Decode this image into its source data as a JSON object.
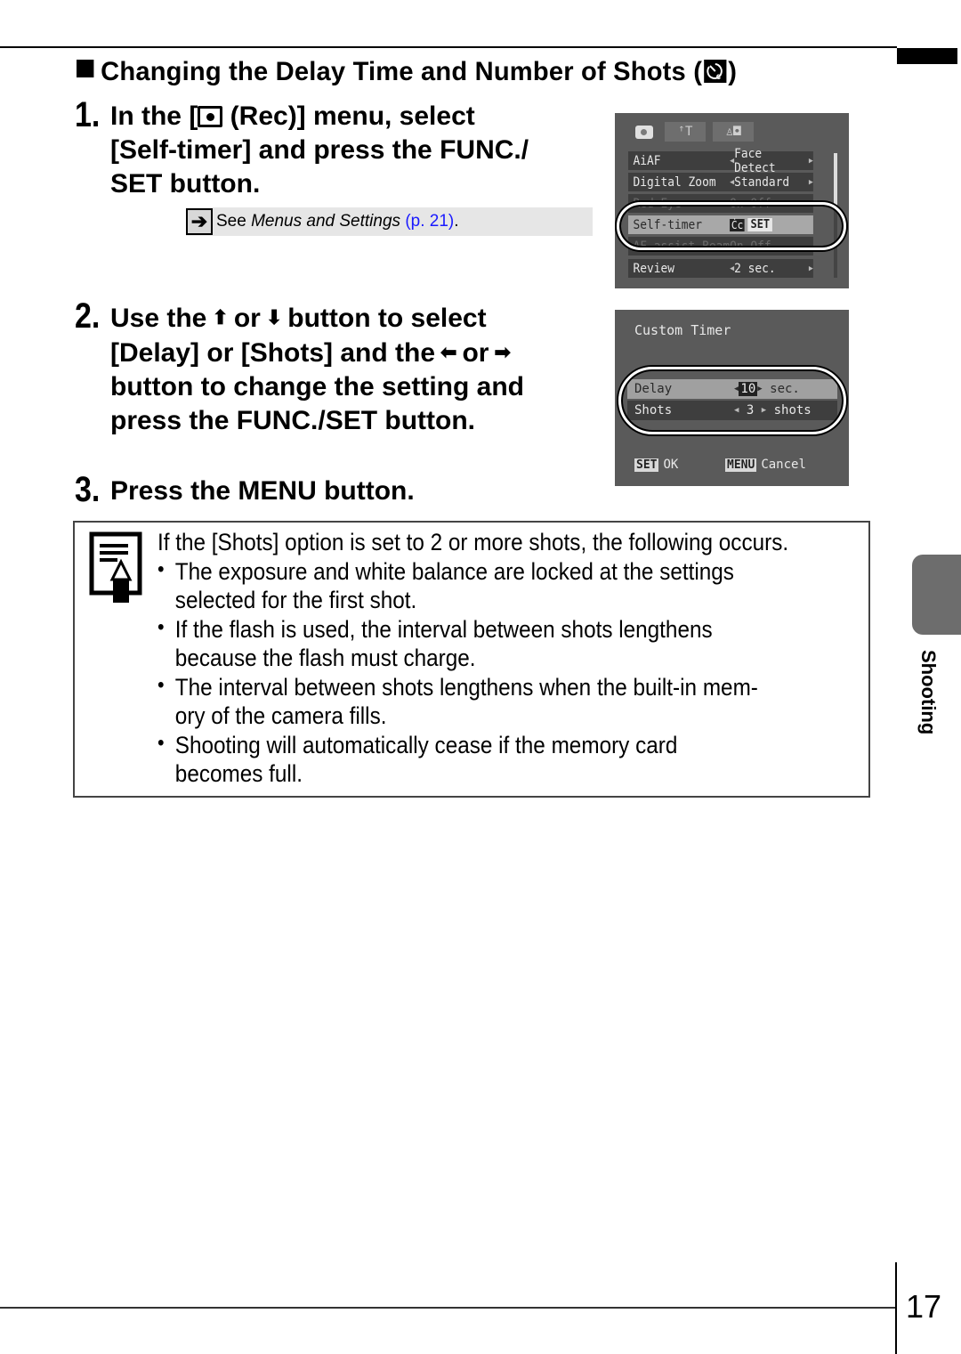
{
  "section": {
    "title": "Changing the Delay Time and Number of Shots (",
    "title_end": ")",
    "title_icon": "custom-self-timer-icon"
  },
  "steps": [
    {
      "number": "1.",
      "lines": [
        "In the [",
        " (Rec)] menu, select",
        "[Self-timer] and press the FUNC./",
        "SET button."
      ],
      "icon": "rec-camera-icon"
    },
    {
      "number": "2.",
      "line1_a": "Use the",
      "line1_b": "or",
      "line1_c": "button to select",
      "line2_a": "[Delay] or [Shots] and the",
      "line2_b": "or",
      "line3": "button to change the setting and",
      "line4": "press the FUNC./SET button.",
      "icons": [
        "up-arrow-icon",
        "down-arrow-icon",
        "left-arrow-icon",
        "right-arrow-icon"
      ]
    },
    {
      "number": "3.",
      "text": "Press the MENU button."
    }
  ],
  "see_reference": {
    "prefix": "See ",
    "title": "Menus and Settings",
    "page_link": "(p. 21)",
    "suffix": ".",
    "link_color": "#1a1aff"
  },
  "screen1": {
    "tabs": [
      "camera",
      "tools",
      "my-menu"
    ],
    "rows": [
      {
        "label": "AiAF",
        "value": "Face Detect"
      },
      {
        "label": "Digital Zoom",
        "value": "Standard"
      },
      {
        "label": "Red-Eye",
        "value": "On Off"
      },
      {
        "label": "Self-timer",
        "value": "SET",
        "selected": true
      },
      {
        "label": "AF-assist Beam",
        "value": "On Off"
      },
      {
        "label": "Review",
        "value": "2 sec."
      }
    ]
  },
  "screen2": {
    "title": "Custom Timer",
    "delay_label": "Delay",
    "delay_value": "10",
    "delay_unit": "sec.",
    "shots_label": "Shots",
    "shots_value": "3",
    "shots_unit": "shots",
    "ok_key": "SET",
    "ok_label": "OK",
    "cancel_key": "MENU",
    "cancel_label": "Cancel"
  },
  "note": {
    "intro": "If the [Shots] option is set to 2 or more shots, the following occurs.",
    "bullets": [
      [
        "The exposure and white balance are locked at the settings",
        "selected for the first shot."
      ],
      [
        "If the flash is used, the interval between shots lengthens",
        "because the flash must charge."
      ],
      [
        "The interval between shots lengthens when the built-in mem-",
        "ory of the camera fills."
      ],
      [
        "Shooting will automatically cease if the memory card",
        "becomes full."
      ]
    ]
  },
  "side_tab": {
    "label": "Shooting",
    "color": "#6d6d6d"
  },
  "page_number": "17"
}
